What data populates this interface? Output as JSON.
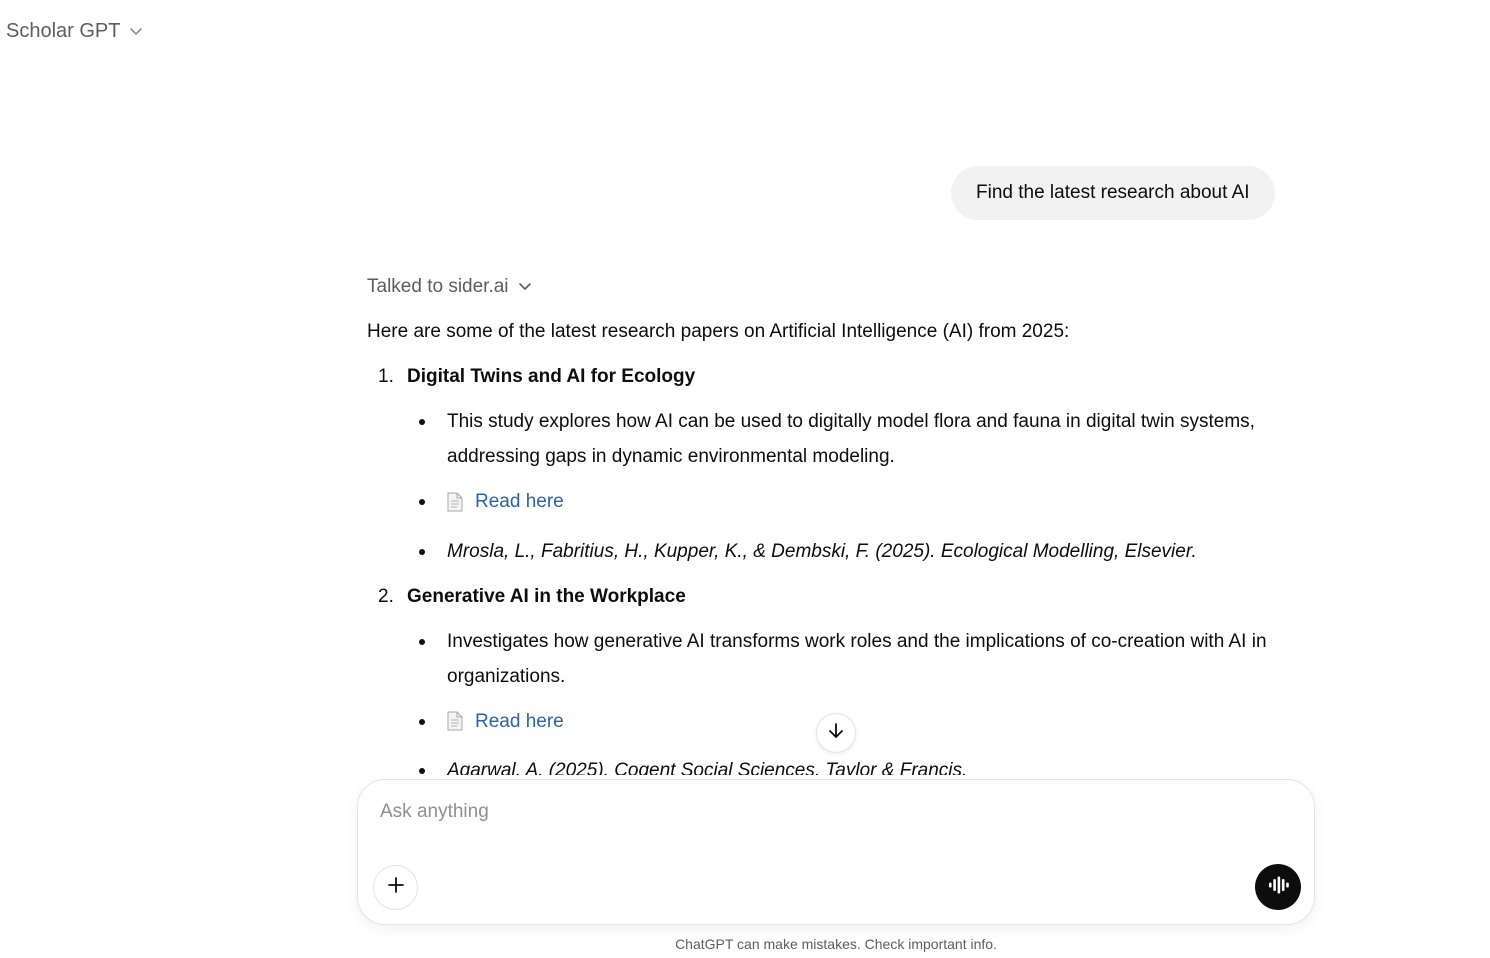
{
  "header": {
    "title": "Scholar GPT",
    "menu_icon": "chevron-down-icon"
  },
  "conversation": {
    "user_message": "Find the latest research about AI",
    "assistant": {
      "tool_status": "Talked to sider.ai",
      "intro": "Here are some of the latest research papers on Artificial Intelligence (AI) from 2025:",
      "papers": [
        {
          "number": "1.",
          "title": "Digital Twins and AI for Ecology",
          "summary": "This study explores how AI can be used to digitally model flora and fauna in digital twin systems, addressing gaps in dynamic environmental modeling.",
          "link_label": "Read here",
          "link_icon": "document-icon",
          "citation": "Mrosla, L., Fabritius, H., Kupper, K., & Dembski, F. (2025). Ecological Modelling, Elsevier."
        },
        {
          "number": "2.",
          "title": "Generative AI in the Workplace",
          "summary": "Investigates how generative AI transforms work roles and the implications of co-creation with AI in organizations.",
          "link_label": "Read here",
          "link_icon": "document-icon",
          "citation": "Agarwal, A. (2025). Cogent Social Sciences, Taylor & Francis."
        }
      ]
    }
  },
  "composer": {
    "placeholder": "Ask anything",
    "value": "",
    "add_icon": "plus-icon",
    "voice_icon": "voice-waveform-icon"
  },
  "scroll_button_icon": "arrow-down-icon",
  "footer": {
    "disclaimer": "ChatGPT can make mistakes. Check important info."
  }
}
